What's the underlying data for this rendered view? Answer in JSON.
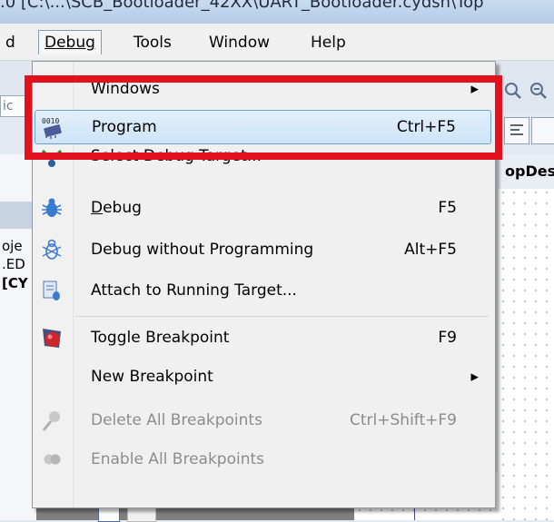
{
  "window": {
    "title": ".0  [C:\\...\\SCB_Bootloader_42XX\\UART_Bootloader.cydsn\\Top"
  },
  "menubar": {
    "items": [
      {
        "label": "d"
      },
      {
        "label": "Debug"
      },
      {
        "label": "Tools"
      },
      {
        "label": "Window"
      },
      {
        "label": "Help"
      }
    ]
  },
  "background": {
    "toolbar_input_fragment": "ic",
    "pane_header": "opDes",
    "left_lines": [
      "oje",
      ".ED",
      "[CY"
    ]
  },
  "menu": {
    "items": [
      {
        "label": "Windows",
        "shortcut": "",
        "icon": "none",
        "submenu": true,
        "disabled": false
      },
      {
        "label": "Program",
        "shortcut": "Ctrl+F5",
        "icon": "chip-program-icon",
        "submenu": false,
        "disabled": false,
        "highlighted": true
      },
      {
        "label": "Select Debug Target...",
        "shortcut": "",
        "icon": "select-target-icon",
        "submenu": false,
        "disabled": false
      },
      {
        "label": "Debug",
        "shortcut": "F5",
        "icon": "bug-icon",
        "submenu": false,
        "disabled": false
      },
      {
        "label": "Debug without Programming",
        "shortcut": "Alt+F5",
        "icon": "bug-outline-icon",
        "submenu": false,
        "disabled": false
      },
      {
        "label": "Attach to Running Target...",
        "shortcut": "",
        "icon": "attach-target-icon",
        "submenu": false,
        "disabled": false
      },
      {
        "label": "Toggle Breakpoint",
        "shortcut": "F9",
        "icon": "breakpoint-icon",
        "submenu": false,
        "disabled": false
      },
      {
        "label": "New Breakpoint",
        "shortcut": "",
        "icon": "none",
        "submenu": true,
        "disabled": false
      },
      {
        "label": "Delete All Breakpoints",
        "shortcut": "Ctrl+Shift+F9",
        "icon": "delete-breakpoints-icon",
        "submenu": false,
        "disabled": true
      },
      {
        "label": "Enable All Breakpoints",
        "shortcut": "",
        "icon": "enable-breakpoints-icon",
        "submenu": false,
        "disabled": true
      }
    ]
  },
  "colors": {
    "highlight_border": "#6aa2d8",
    "annotation_red": "#e3101d",
    "disabled_text": "#8c8c8c"
  }
}
